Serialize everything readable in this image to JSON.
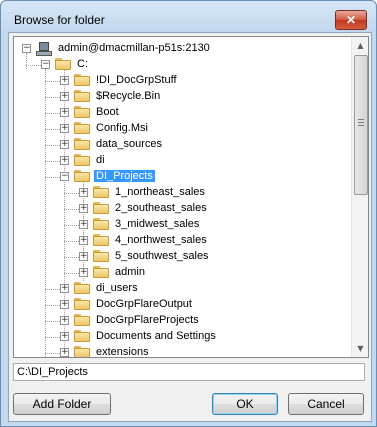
{
  "window": {
    "title": "Browse for folder",
    "close_glyph": "✕"
  },
  "tree": {
    "items": [
      {
        "label": "admin@dmacmillan-p51s:2130",
        "icon": "computer-icon",
        "expander": "−",
        "level": 0
      },
      {
        "label": "C:",
        "icon": "folder-icon",
        "expander": "−",
        "level": 1
      },
      {
        "label": "!DI_DocGrpStuff",
        "icon": "folder-icon",
        "expander": "+",
        "level": 2
      },
      {
        "label": "$Recycle.Bin",
        "icon": "folder-icon",
        "expander": "+",
        "level": 2
      },
      {
        "label": "Boot",
        "icon": "folder-icon",
        "expander": "+",
        "level": 2
      },
      {
        "label": "Config.Msi",
        "icon": "folder-icon",
        "expander": "+",
        "level": 2
      },
      {
        "label": "data_sources",
        "icon": "folder-icon",
        "expander": "+",
        "level": 2
      },
      {
        "label": "di",
        "icon": "folder-icon",
        "expander": "+",
        "level": 2
      },
      {
        "label": "DI_Projects",
        "icon": "folder-icon",
        "expander": "−",
        "level": 2,
        "selected": true
      },
      {
        "label": "1_northeast_sales",
        "icon": "folder-icon",
        "expander": "+",
        "level": 3
      },
      {
        "label": "2_southeast_sales",
        "icon": "folder-icon",
        "expander": "+",
        "level": 3
      },
      {
        "label": "3_midwest_sales",
        "icon": "folder-icon",
        "expander": "+",
        "level": 3
      },
      {
        "label": "4_northwest_sales",
        "icon": "folder-icon",
        "expander": "+",
        "level": 3
      },
      {
        "label": "5_southwest_sales",
        "icon": "folder-icon",
        "expander": "+",
        "level": 3
      },
      {
        "label": "admin",
        "icon": "folder-icon",
        "expander": "+",
        "level": 3
      },
      {
        "label": "di_users",
        "icon": "folder-icon",
        "expander": "+",
        "level": 2
      },
      {
        "label": "DocGrpFlareOutput",
        "icon": "folder-icon",
        "expander": "+",
        "level": 2
      },
      {
        "label": "DocGrpFlareProjects",
        "icon": "folder-icon",
        "expander": "+",
        "level": 2
      },
      {
        "label": "Documents and Settings",
        "icon": "folder-icon",
        "expander": "+",
        "level": 2
      },
      {
        "label": "extensions",
        "icon": "folder-icon",
        "expander": "+",
        "level": 2
      }
    ],
    "scroll": {
      "up_glyph": "▲",
      "down_glyph": "▼"
    }
  },
  "path_field": {
    "value": "C:\\DI_Projects"
  },
  "buttons": {
    "add_folder": "Add Folder",
    "ok": "OK",
    "cancel": "Cancel"
  },
  "colors": {
    "selection": "#3399ff",
    "folder": "#e9c66a",
    "close": "#c13a22"
  }
}
